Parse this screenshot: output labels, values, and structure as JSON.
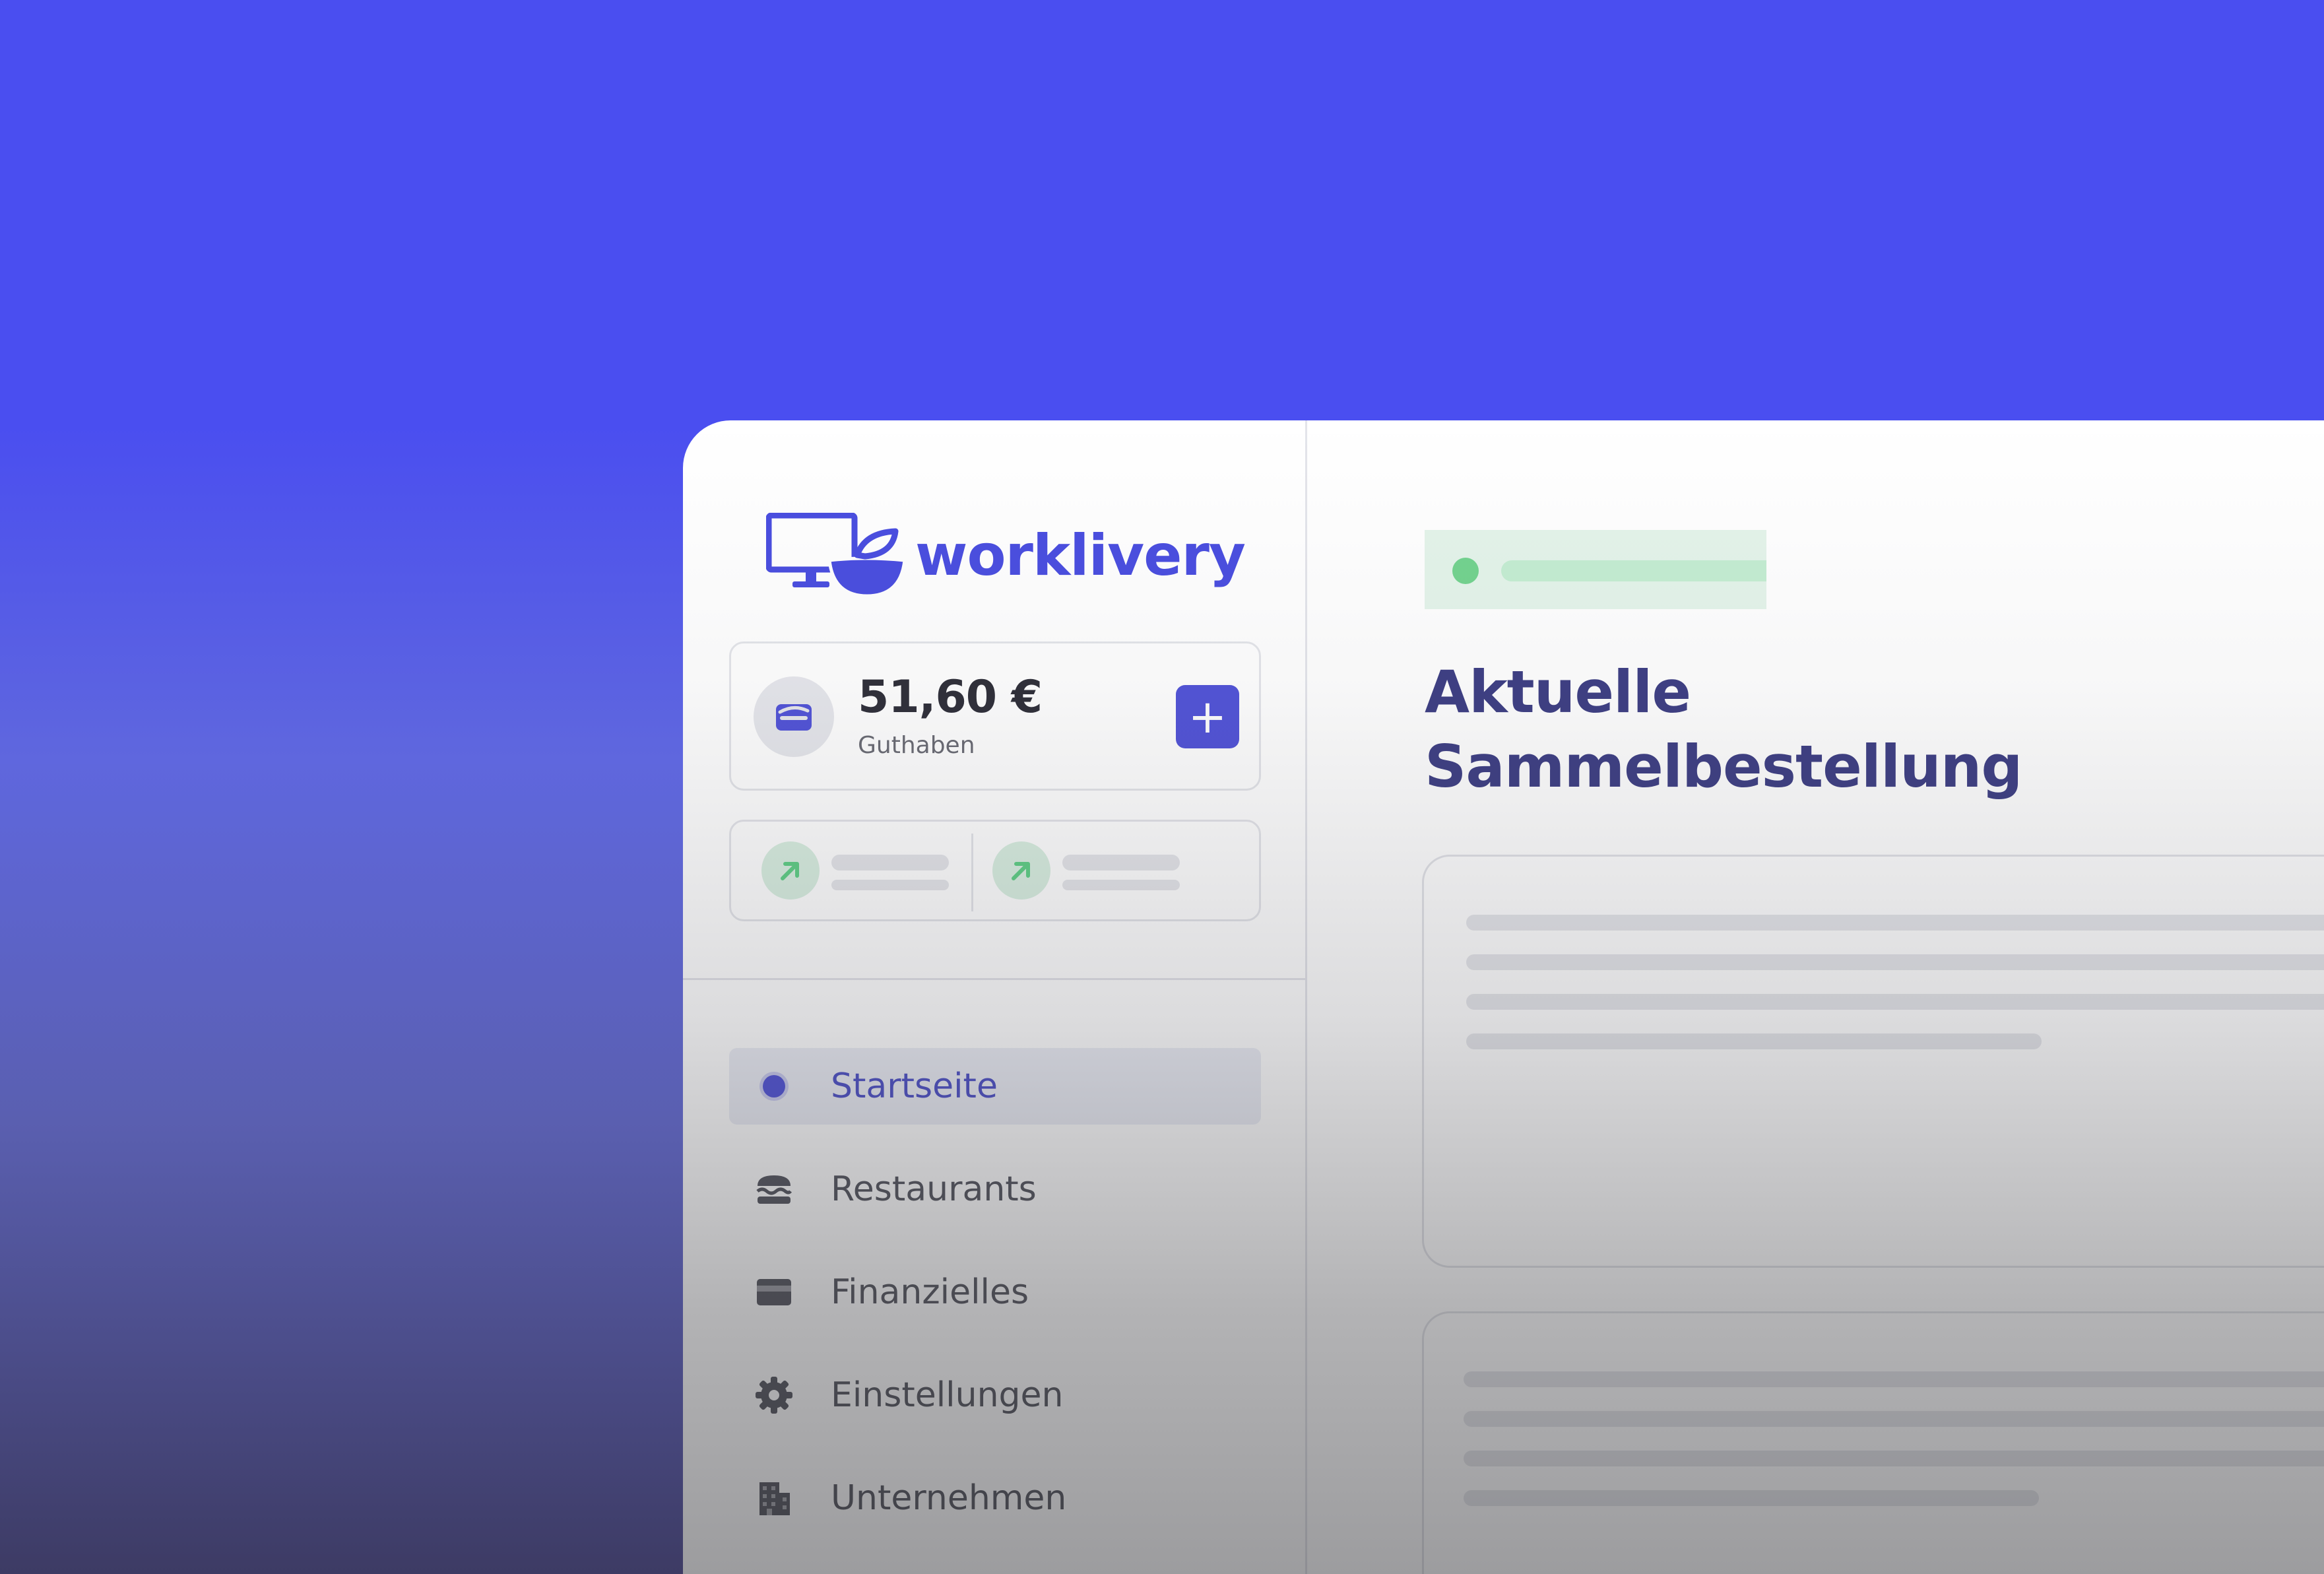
{
  "brand": {
    "name": "worklivery",
    "color": "#4a4ee0"
  },
  "balance": {
    "amount": "51,60 €",
    "label": "Guthaben",
    "topup_symbol": "+"
  },
  "nav": {
    "items": [
      {
        "label": "Startseite",
        "icon": "home-dot-icon",
        "active": true
      },
      {
        "label": "Restaurants",
        "icon": "burger-icon",
        "active": false
      },
      {
        "label": "Finanzielles",
        "icon": "credit-card-icon",
        "active": false
      },
      {
        "label": "Einstellungen",
        "icon": "gear-icon",
        "active": false
      },
      {
        "label": "Unternehmen",
        "icon": "building-icon",
        "active": false
      }
    ]
  },
  "main": {
    "title_line1": "Aktuelle",
    "title_line2": "Sammelbestellung",
    "status_color": "#73d38f"
  },
  "colors": {
    "background": "#4a4ef0",
    "accent": "#5254d8",
    "stat_arrow": "#5fcf86"
  }
}
